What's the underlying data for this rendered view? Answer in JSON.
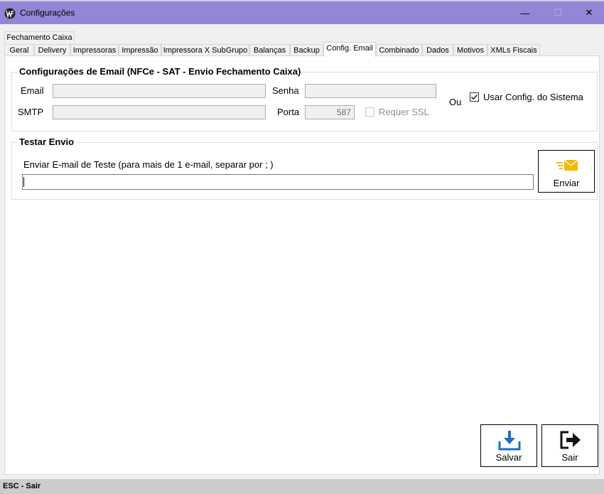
{
  "window": {
    "title": "Configurações",
    "minimize": "—",
    "maximize": "☐",
    "close": "✕"
  },
  "tabs_row1": [
    "Fechamento Caixa"
  ],
  "tabs_row2": [
    "Geral",
    "Delivery",
    "Impressoras",
    "Impressão",
    "Impressora X SubGrupo",
    "Balanças",
    "Backup",
    "Config. Email",
    "Combinado",
    "Dados",
    "Motivos",
    "XMLs Fiscais"
  ],
  "active_tab": "Config. Email",
  "email_config": {
    "group_title": "Configurações de Email (NFCe - SAT - Envio Fechamento Caixa)",
    "email_label": "Email",
    "email_value": "",
    "senha_label": "Senha",
    "senha_value": "",
    "smtp_label": "SMTP",
    "smtp_value": "",
    "porta_label": "Porta",
    "porta_value": "587",
    "ssl_label": "Requer SSL",
    "ssl_checked": false,
    "ou_label": "Ou",
    "system_label": "Usar Config. do Sistema",
    "system_checked": true
  },
  "test_send": {
    "group_title": "Testar Envio",
    "instruction": "Enviar E-mail de Teste (para mais de 1 e-mail, separar por ; )",
    "email_value": "",
    "send_label": "Enviar"
  },
  "actions": {
    "save_label": "Salvar",
    "exit_label": "Sair"
  },
  "status": {
    "text": "ESC - Sair"
  },
  "colors": {
    "titlebar": "#9386d6",
    "envelope": "#f5b800",
    "save_icon": "#1a6fc4"
  }
}
